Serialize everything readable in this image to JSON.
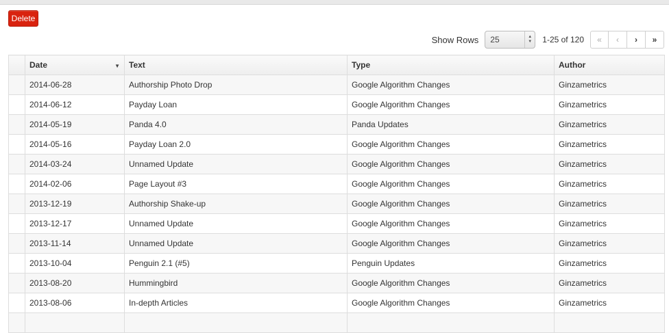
{
  "toolbar": {
    "delete_label": "Delete",
    "show_rows_label": "Show Rows",
    "rows_value": "25",
    "range_text": "1-25 of 120",
    "pager": {
      "first": "«",
      "prev": "‹",
      "next": "›",
      "last": "»"
    }
  },
  "table": {
    "columns": {
      "date": "Date",
      "text": "Text",
      "type": "Type",
      "author": "Author"
    },
    "rows": [
      {
        "date": "2014-06-28",
        "text": "Authorship Photo Drop",
        "type": "Google Algorithm Changes",
        "author": "Ginzametrics"
      },
      {
        "date": "2014-06-12",
        "text": "Payday Loan",
        "type": "Google Algorithm Changes",
        "author": "Ginzametrics"
      },
      {
        "date": "2014-05-19",
        "text": "Panda 4.0",
        "type": "Panda Updates",
        "author": "Ginzametrics"
      },
      {
        "date": "2014-05-16",
        "text": "Payday Loan 2.0",
        "type": "Google Algorithm Changes",
        "author": "Ginzametrics"
      },
      {
        "date": "2014-03-24",
        "text": "Unnamed Update",
        "type": "Google Algorithm Changes",
        "author": "Ginzametrics"
      },
      {
        "date": "2014-02-06",
        "text": "Page Layout #3",
        "type": "Google Algorithm Changes",
        "author": "Ginzametrics"
      },
      {
        "date": "2013-12-19",
        "text": "Authorship Shake-up",
        "type": "Google Algorithm Changes",
        "author": "Ginzametrics"
      },
      {
        "date": "2013-12-17",
        "text": "Unnamed Update",
        "type": "Google Algorithm Changes",
        "author": "Ginzametrics"
      },
      {
        "date": "2013-11-14",
        "text": "Unnamed Update",
        "type": "Google Algorithm Changes",
        "author": "Ginzametrics"
      },
      {
        "date": "2013-10-04",
        "text": "Penguin 2.1 (#5)",
        "type": "Penguin Updates",
        "author": "Ginzametrics"
      },
      {
        "date": "2013-08-20",
        "text": "Hummingbird",
        "type": "Google Algorithm Changes",
        "author": "Ginzametrics"
      },
      {
        "date": "2013-08-06",
        "text": "In-depth Articles",
        "type": "Google Algorithm Changes",
        "author": "Ginzametrics"
      },
      {
        "date": "",
        "text": "",
        "type": "",
        "author": ""
      }
    ]
  },
  "colors": {
    "delete_bg": "#d9230f",
    "row_alt": "#f7f7f7",
    "border": "#dddddd"
  }
}
